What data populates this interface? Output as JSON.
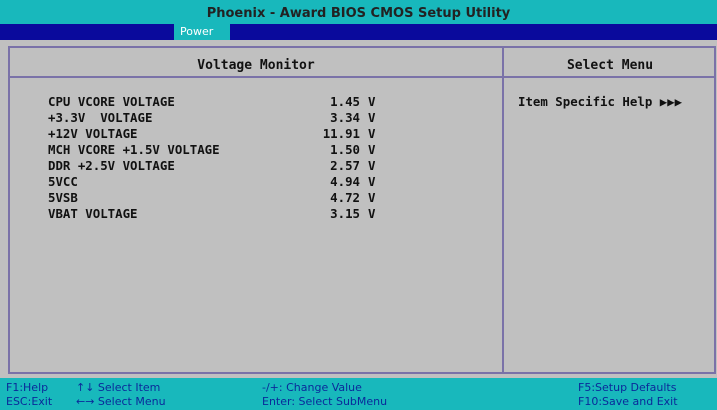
{
  "title": "Phoenix - Award BIOS CMOS Setup Utility",
  "active_menu": "Power",
  "panel": {
    "title": "Voltage Monitor",
    "items": [
      {
        "label": "CPU VCORE VOLTAGE",
        "value": "1.45",
        "unit": "V"
      },
      {
        "label": "+3.3V  VOLTAGE",
        "value": "3.34",
        "unit": "V"
      },
      {
        "label": "+12V VOLTAGE",
        "value": "11.91",
        "unit": "V"
      },
      {
        "label": "MCH VCORE +1.5V VOLTAGE",
        "value": "1.50",
        "unit": "V"
      },
      {
        "label": "DDR +2.5V VOLTAGE",
        "value": "2.57",
        "unit": "V"
      },
      {
        "label": "5VCC",
        "value": "4.94",
        "unit": "V"
      },
      {
        "label": "5VSB",
        "value": "4.72",
        "unit": "V"
      },
      {
        "label": "VBAT VOLTAGE",
        "value": "3.15",
        "unit": "V"
      }
    ]
  },
  "help_panel": {
    "title": "Select Menu",
    "text": "Item Specific Help ▶▶▶"
  },
  "footer": {
    "f1": "F1:Help",
    "esc": "ESC:Exit",
    "select_item": "↑↓ Select Item",
    "select_menu": "←→ Select Menu",
    "change_value": "-/+: Change Value",
    "enter": "Enter: Select SubMenu",
    "f5": "F5:Setup Defaults",
    "f10": "F10:Save and Exit"
  },
  "colors": {
    "title_bg": "#18b8bc",
    "menu_bg": "#0a0a9c",
    "panel_bg": "#c0c0c0",
    "frame": "#7a72a8",
    "footer_text": "#0a2a9a"
  }
}
